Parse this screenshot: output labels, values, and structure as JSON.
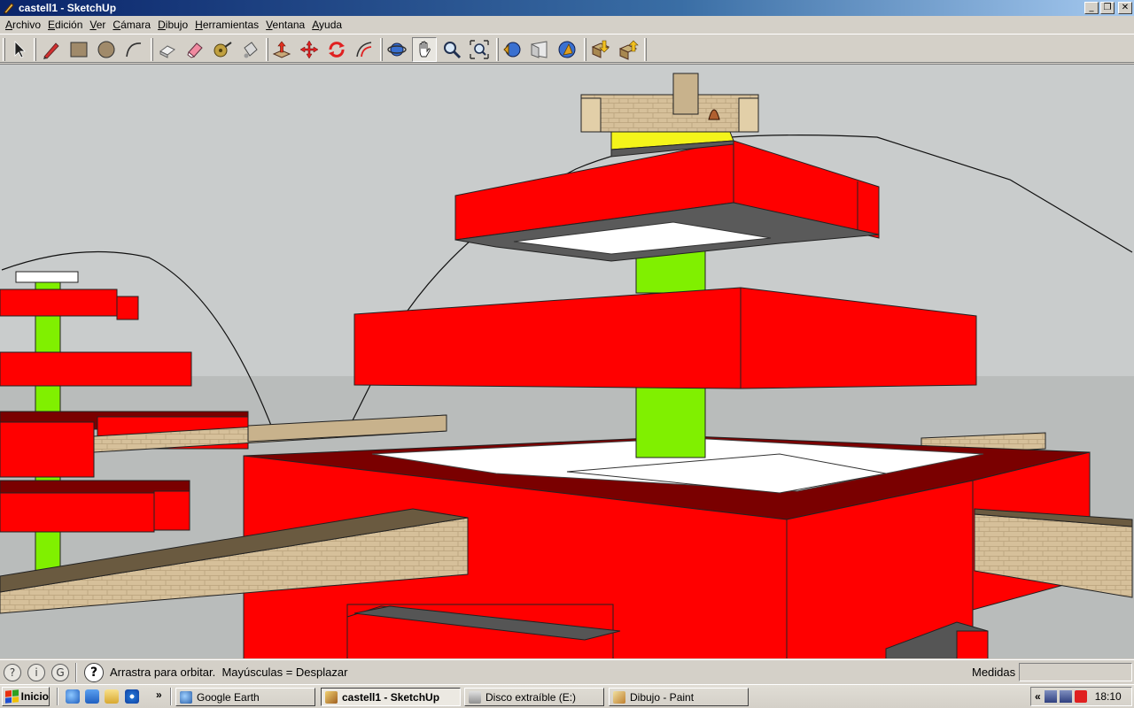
{
  "window": {
    "title": "castell1 - SketchUp",
    "controls": {
      "minimize": "_",
      "maximize": "❐",
      "close": "✕"
    }
  },
  "menu": {
    "items": [
      {
        "u": "A",
        "rest": "rchivo"
      },
      {
        "u": "E",
        "rest": "dición"
      },
      {
        "u": "V",
        "rest": "er"
      },
      {
        "u": "C",
        "rest": "ámara"
      },
      {
        "u": "D",
        "rest": "ibujo"
      },
      {
        "u": "H",
        "rest": "erramientas"
      },
      {
        "u": "V",
        "rest": "entana"
      },
      {
        "u": "A",
        "rest": "yuda"
      }
    ]
  },
  "toolbar": {
    "tools": [
      "select-icon",
      "pencil-icon",
      "rectangle-icon",
      "circle-icon",
      "arc-icon",
      "make-component-icon",
      "eraser-icon",
      "tape-measure-icon",
      "paint-bucket-icon",
      "push-pull-icon",
      "move-icon",
      "rotate-icon",
      "offset-icon",
      "orbit-icon",
      "pan-icon",
      "zoom-icon",
      "zoom-extents-icon",
      "previous-view-icon",
      "next-view-icon",
      "standard-views-icon",
      "get-models-icon",
      "share-model-icon"
    ],
    "active_tool": "pan-icon"
  },
  "statusbar": {
    "help_glyph": "?",
    "hint": "Arrastra para orbitar.  Mayúsculas = Desplazar",
    "measure_label": "Medidas",
    "measure_value": ""
  },
  "taskbar": {
    "start_label": "Inicio",
    "more_glyph": "»",
    "tasks": [
      {
        "label": "Google Earth",
        "active": false
      },
      {
        "label": "castell1 - SketchUp",
        "active": true
      },
      {
        "label": "Disco extraíble (E:)",
        "active": false
      },
      {
        "label": "Dibujo - Paint",
        "active": false
      }
    ],
    "tray_more": "«",
    "clock": "18:10"
  },
  "colors": {
    "sky": "#c9cccc",
    "ground": "#b9bcbb",
    "wall_red": "#ff0000",
    "wall_dark_red": "#7a0000",
    "column_green": "#80f000",
    "accent_yellow": "#f4f41a",
    "stone": "#d6c09a"
  }
}
